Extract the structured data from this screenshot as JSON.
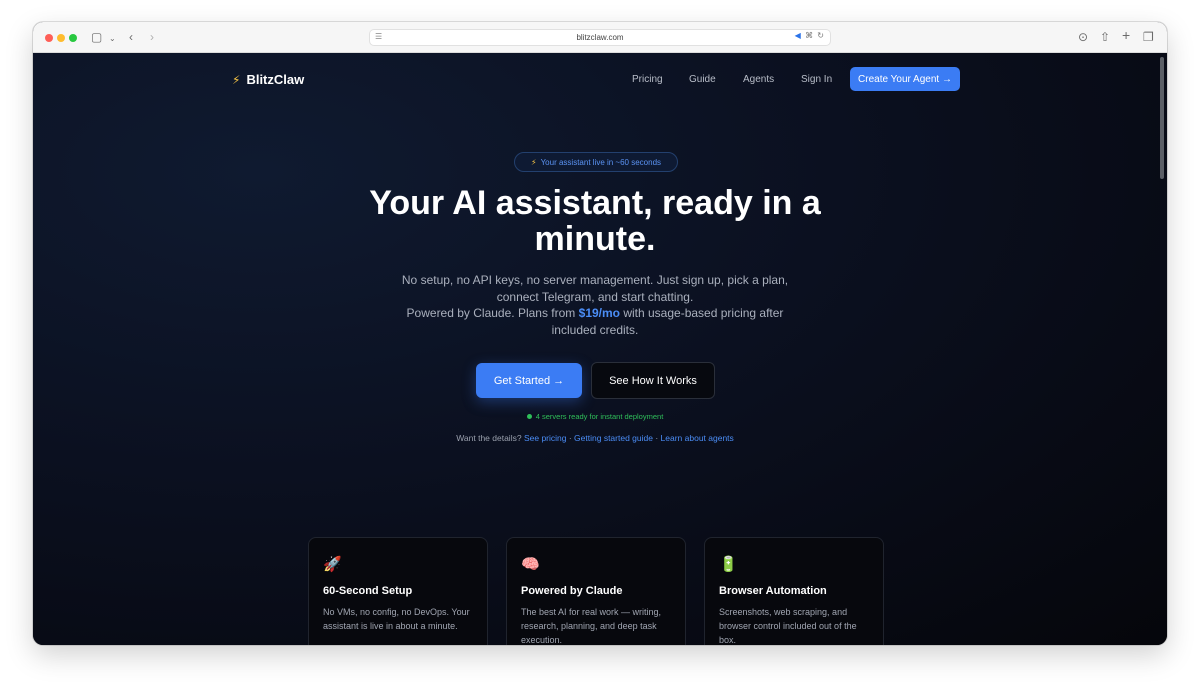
{
  "browser": {
    "url": "blitzclaw.com"
  },
  "nav": {
    "brand": "BlitzClaw",
    "links": [
      "Pricing",
      "Guide",
      "Agents",
      "Sign In"
    ],
    "cta": "Create Your Agent →"
  },
  "hero": {
    "pill": "Your assistant live in ~60 seconds",
    "title": "Your AI assistant, ready in a minute.",
    "sub_line1": "No setup, no API keys, no server management. Just sign up, pick a plan, connect Telegram, and start chatting.",
    "sub_line2_pre": "Powered by Claude. Plans from ",
    "sub_price": "$19/mo",
    "sub_line2_post": " with usage-based pricing after included credits.",
    "primary_button": "Get Started →",
    "secondary_button": "See How It Works",
    "status": "4 servers ready for instant deployment",
    "details_prefix": "Want the details?",
    "details_links": [
      "See pricing",
      "Getting started guide",
      "Learn about agents"
    ],
    "details_sep": " · "
  },
  "features": [
    {
      "emoji": "🚀",
      "title": "60-Second Setup",
      "desc": "No VMs, no config, no DevOps. Your assistant is live in about a minute."
    },
    {
      "emoji": "🧠",
      "title": "Powered by Claude",
      "desc": "The best AI for real work — writing, research, planning, and deep task execution."
    },
    {
      "emoji": "🔋",
      "title": "Browser Automation",
      "desc": "Screenshots, web scraping, and browser control included out of the box."
    }
  ],
  "colors": {
    "accent": "#3b7cf4",
    "status_green": "#2fbf5a",
    "bolt_yellow": "#f6c445"
  }
}
